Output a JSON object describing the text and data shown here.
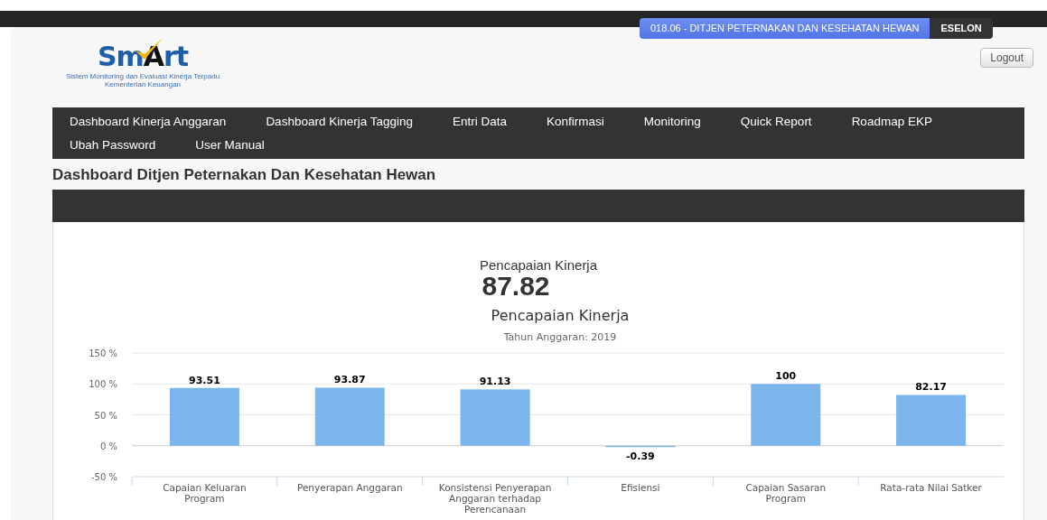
{
  "header": {
    "unit": "018.06 - DITJEN PETERNAKAN DAN KESEHATAN HEWAN",
    "role": "ESELON",
    "logout": "Logout"
  },
  "logo": {
    "prefix": "Sm",
    "mark": "A",
    "suffix": "rt",
    "tagline": "Sistem Monitoring dan Evaluasi Kinerja Terpadu",
    "org": "Kementerian Keuangan"
  },
  "nav": [
    {
      "label": "Dashboard Kinerja Anggaran"
    },
    {
      "label": "Dashboard Kinerja Tagging"
    },
    {
      "label": "Entri Data"
    },
    {
      "label": "Konfirmasi"
    },
    {
      "label": "Monitoring"
    },
    {
      "label": "Quick Report"
    },
    {
      "label": "Roadmap EKP"
    },
    {
      "label": "Ubah Password"
    },
    {
      "label": "User Manual"
    }
  ],
  "page_title": "Dashboard Ditjen Peternakan Dan Kesehatan Hewan",
  "summary": {
    "label": "Pencapaian Kinerja",
    "value": "87.82"
  },
  "chart_data": {
    "type": "bar",
    "title": "Pencapaian Kinerja",
    "subtitle": "Tahun Anggaran: 2019",
    "categories": [
      [
        "Capaian Keluaran",
        "Program"
      ],
      [
        "Penyerapan Anggaran"
      ],
      [
        "Konsistensi Penyerapan",
        "Anggaran terhadap",
        "Perencanaan"
      ],
      [
        "Efisiensi"
      ],
      [
        "Capaian Sasaran",
        "Program"
      ],
      [
        "Rata-rata Nilai Satker"
      ]
    ],
    "series": [
      {
        "color": "#7cb5ec",
        "values": [
          93.51,
          93.87,
          91.13,
          -0.39,
          100,
          82.17
        ]
      }
    ],
    "ylim": [
      -50,
      150
    ],
    "yticks": [
      {
        "value": 150,
        "label": "150 %"
      },
      {
        "value": 100,
        "label": "100 %"
      },
      {
        "value": 50,
        "label": "50 %"
      },
      {
        "value": 0,
        "label": "0 %"
      },
      {
        "value": -50,
        "label": "-50 %"
      }
    ],
    "data_labels": true
  }
}
